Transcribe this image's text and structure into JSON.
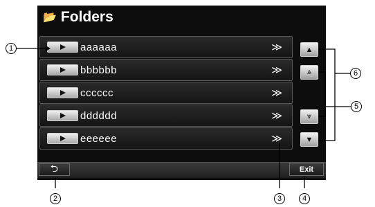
{
  "header": {
    "title": "Folders",
    "icon": "folder-icon"
  },
  "folders": [
    {
      "label": "aaaaaa",
      "chevron": "≫"
    },
    {
      "label": "bbbbbb",
      "chevron": "≫"
    },
    {
      "label": "cccccc",
      "chevron": "≫"
    },
    {
      "label": "dddddd",
      "chevron": "≫"
    },
    {
      "label": "eeeeee",
      "chevron": "≫"
    }
  ],
  "scroll": {
    "up": "▲",
    "page_up": "⩓",
    "page_down": "⩔",
    "down": "▼"
  },
  "footer": {
    "back_icon": "back-arrow-icon",
    "exit_label": "Exit"
  },
  "callouts": [
    "1",
    "2",
    "3",
    "4",
    "5",
    "6"
  ]
}
